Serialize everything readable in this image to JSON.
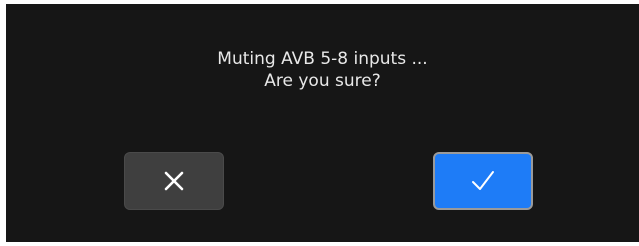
{
  "dialog": {
    "message_line1": "Muting AVB 5-8 inputs ...",
    "message_line2": "Are you sure?",
    "cancel_button": {
      "icon": "close-icon",
      "color": "#3f3f3f"
    },
    "confirm_button": {
      "icon": "check-icon",
      "color": "#1e7cf7"
    }
  },
  "colors": {
    "background": "#161616",
    "text": "#e8e8e8"
  }
}
